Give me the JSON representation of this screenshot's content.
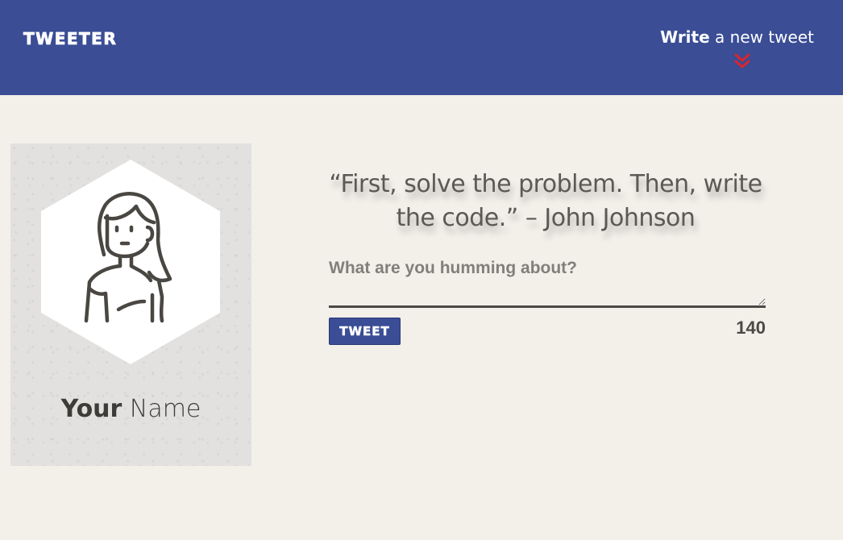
{
  "navbar": {
    "brand": "TWEETER",
    "compose_toggle": {
      "bold_text": "Write",
      "rest_text": "a new tweet"
    },
    "chevron_icon": "double-chevron-down-icon",
    "colors": {
      "background": "#3a4d95",
      "chevron": "#d9262b"
    }
  },
  "profile": {
    "name_bold": "Your",
    "name_rest": "Name",
    "avatar_icon": "user-avatar-icon"
  },
  "composer": {
    "quote": "“First, solve the problem. Then, write the code.” – John Johnson",
    "prompt": "What are you humming about?",
    "textarea_value": "",
    "button_label": "TWEET",
    "char_count": "140"
  },
  "colors": {
    "page_background": "#f3efe9",
    "card_background": "#e2e1df",
    "accent": "#3a4d95"
  }
}
